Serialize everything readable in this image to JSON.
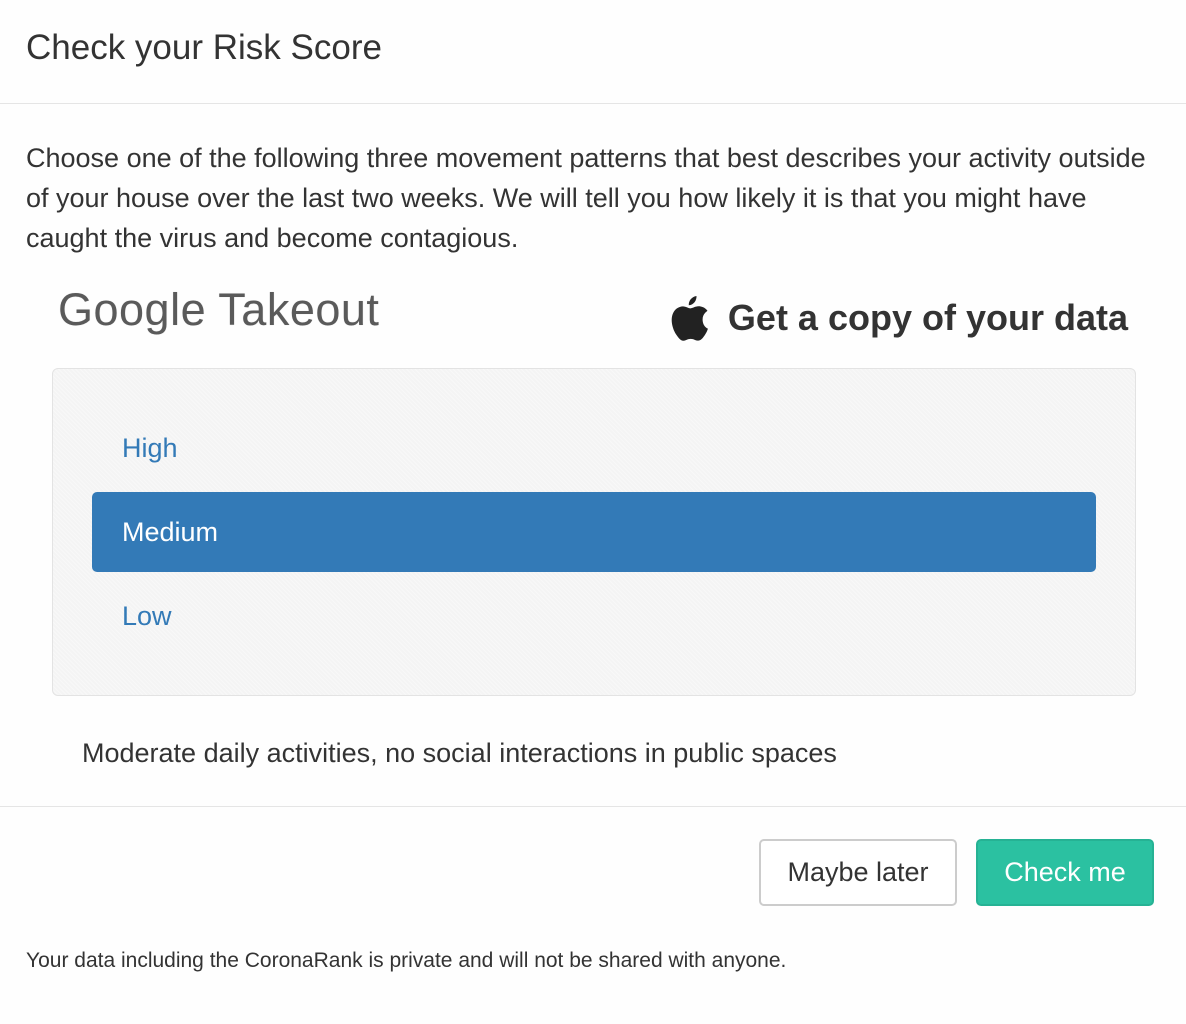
{
  "header": {
    "title": "Check your Risk Score"
  },
  "body": {
    "intro": "Choose one of the following three movement patterns that best describes your activity outside of your house over the last two weeks. We will tell you how likely it is that you might have caught the virus and become contagious.",
    "brands": {
      "google": "Google Takeout",
      "apple_icon": "apple-logo-icon",
      "apple": "Get a copy of your data"
    },
    "options": [
      {
        "label": "High",
        "selected": false
      },
      {
        "label": "Medium",
        "selected": true
      },
      {
        "label": "Low",
        "selected": false
      }
    ],
    "description": "Moderate daily activities, no social interactions in public spaces"
  },
  "footer": {
    "maybe_later_label": "Maybe later",
    "check_me_label": "Check me",
    "privacy": "Your data including the CoronaRank is private and will not be shared with anyone."
  },
  "colors": {
    "accent": "#337ab7",
    "primary_button": "#2bc1a1",
    "text": "#333333"
  }
}
